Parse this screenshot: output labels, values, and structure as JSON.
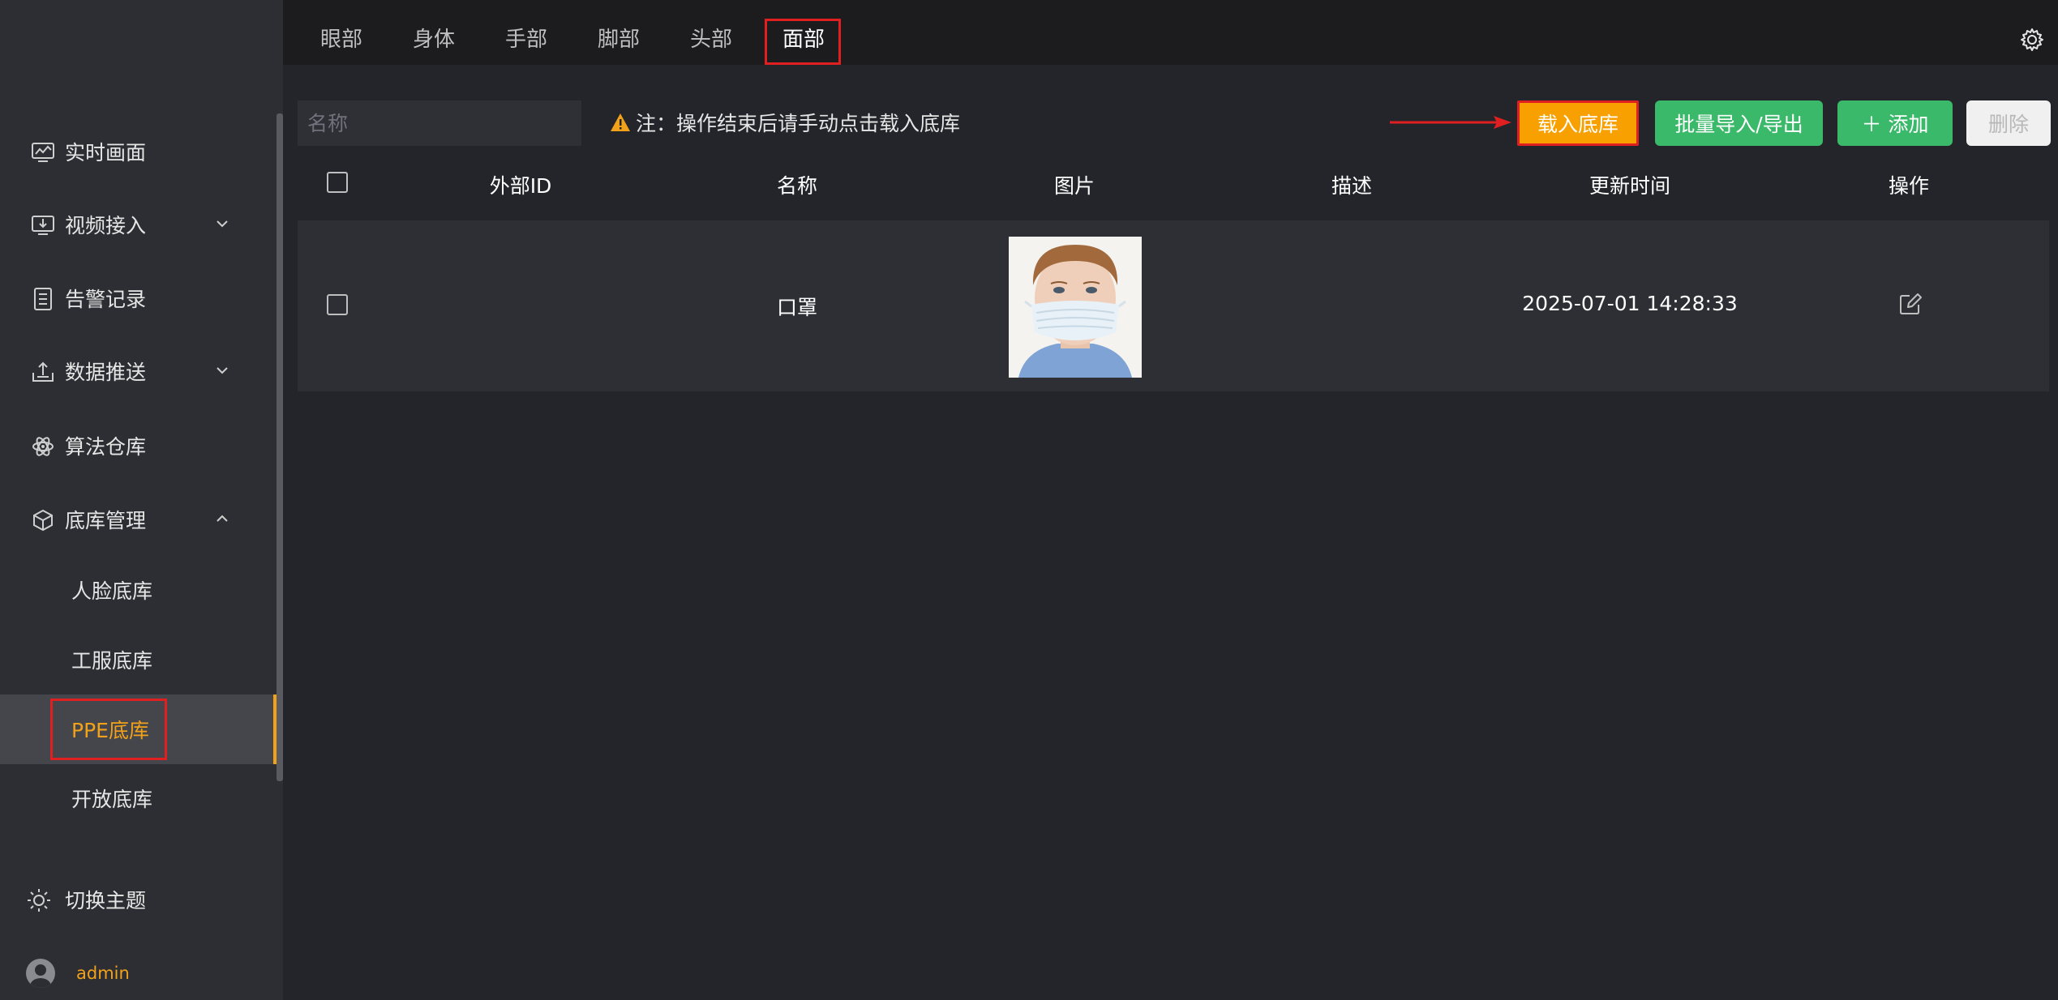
{
  "sidebar": {
    "items": [
      {
        "label": "实时画面",
        "icon": "monitor-chart-icon"
      },
      {
        "label": "视频接入",
        "icon": "video-input-icon"
      },
      {
        "label": "告警记录",
        "icon": "document-list-icon"
      },
      {
        "label": "数据推送",
        "icon": "upload-tray-icon"
      },
      {
        "label": "算法仓库",
        "icon": "atom-icon"
      },
      {
        "label": "底库管理",
        "icon": "cube-icon"
      }
    ],
    "sub_items": [
      "人脸底库",
      "工服底库",
      "PPE底库",
      "开放底库"
    ],
    "active_sub_item": "PPE底库",
    "theme_label": "切换主题",
    "username": "admin"
  },
  "tabs": [
    "眼部",
    "身体",
    "手部",
    "脚部",
    "头部",
    "面部"
  ],
  "active_tab": "面部",
  "toolbar": {
    "search_placeholder": "名称",
    "note": "注：操作结束后请手动点击载入底库",
    "load_label": "载入底库",
    "batch_label": "批量导入/导出",
    "add_label": "＋ 添加",
    "delete_label": "删除"
  },
  "table": {
    "columns": [
      "外部ID",
      "名称",
      "图片",
      "描述",
      "更新时间",
      "操作"
    ],
    "rows": [
      {
        "external_id": "",
        "name": "口罩",
        "image": "child-wearing-mask",
        "description": "",
        "updated": "2025-07-01 14:28:33"
      }
    ]
  },
  "colors": {
    "accent": "#f2a11a",
    "primary_green": "#3bb96a",
    "load_button": "#f7a000",
    "highlight_red": "#e02020"
  }
}
